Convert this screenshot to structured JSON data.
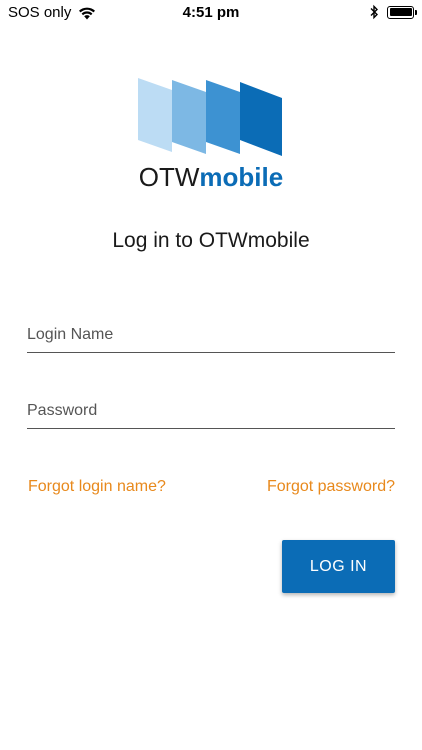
{
  "status_bar": {
    "carrier": "SOS only",
    "time": "4:51 pm",
    "icons": [
      "wifi-icon",
      "bluetooth-icon",
      "battery-icon"
    ]
  },
  "logo": {
    "wordmark_part1": "OTW",
    "wordmark_part2": "mobile",
    "colors": [
      "#bcdcf4",
      "#7db8e4",
      "#3d92d2",
      "#0b6cb6"
    ]
  },
  "page_title": "Log in to OTWmobile",
  "form": {
    "login_name_placeholder": "Login Name",
    "login_name_value": "",
    "password_placeholder": "Password",
    "password_value": ""
  },
  "links": {
    "forgot_login": "Forgot login name?",
    "forgot_password": "Forgot password?"
  },
  "login_button_label": "LOG IN",
  "colors": {
    "accent": "#0b6cb6",
    "link": "#e8891c",
    "background": "#ffffff"
  }
}
